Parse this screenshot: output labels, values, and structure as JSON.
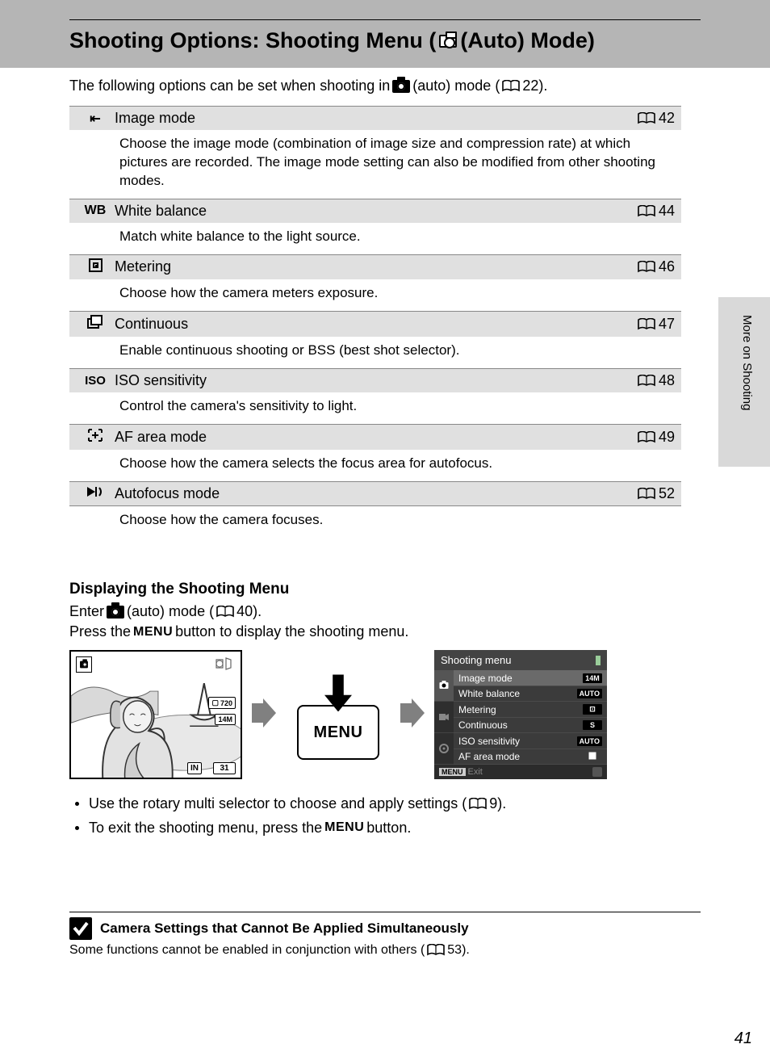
{
  "title_prefix": "Shooting Options: Shooting Menu (",
  "title_mode_word": " (Auto) Mode)",
  "intro_text_1": "The following options can be set when shooting in ",
  "intro_text_2": " (auto) mode (",
  "intro_ref": " 22).",
  "options": [
    {
      "label": "Image mode",
      "page": "42",
      "desc": "Choose the image mode (combination of image size and compression rate) at which pictures are recorded. The image mode setting can also be modified from other shooting modes."
    },
    {
      "label": "White balance",
      "page": "44",
      "desc": "Match white balance to the light source."
    },
    {
      "label": "Metering",
      "page": "46",
      "desc": "Choose how the camera meters exposure."
    },
    {
      "label": "Continuous",
      "page": "47",
      "desc": "Enable continuous shooting or BSS (best shot selector)."
    },
    {
      "label": "ISO sensitivity",
      "page": "48",
      "desc": "Control the camera's sensitivity to light."
    },
    {
      "label": "AF area mode",
      "page": "49",
      "desc": "Choose how the camera selects the focus area for autofocus."
    },
    {
      "label": "Autofocus mode",
      "page": "52",
      "desc": "Choose how the camera focuses."
    }
  ],
  "option_icons": {
    "image_mode_glyph": "⇤",
    "wb_glyph": "WB",
    "metering_glyph": "⊡",
    "continuous_glyph": "❐",
    "iso_glyph": "ISO",
    "af_area_glyph": "[+]",
    "autofocus_glyph": "▷)"
  },
  "subtitle": "Displaying the Shooting Menu",
  "enter_text_1": "Enter ",
  "enter_text_2": " (auto) mode (",
  "enter_ref": " 40).",
  "press_text_1": "Press the ",
  "press_menu": "MENU",
  "press_text_2": " button to display the shooting menu.",
  "menu_button_label": "MENU",
  "camera_menu": {
    "title": "Shooting menu",
    "items": [
      {
        "label": "Image mode",
        "value": "14M"
      },
      {
        "label": "White balance",
        "value": "AUTO"
      },
      {
        "label": "Metering",
        "value": "⊡"
      },
      {
        "label": "Continuous",
        "value": "S"
      },
      {
        "label": "ISO sensitivity",
        "value": "AUTO"
      },
      {
        "label": "AF area mode",
        "value": "▮"
      }
    ],
    "exit_label": "Exit",
    "exit_tag": "MENU"
  },
  "screen_badges": {
    "movie": "720",
    "res": "14M",
    "card": "IN",
    "count": "31"
  },
  "bullets": [
    {
      "t1": "Use the rotary multi selector to choose and apply settings (",
      "ref": " 9)."
    },
    {
      "t1": "To exit the shooting menu, press the ",
      "menu": "MENU",
      "t2": " button."
    }
  ],
  "note": {
    "icon": "V",
    "title": "Camera Settings that Cannot Be Applied Simultaneously",
    "body_1": "Some functions cannot be enabled in conjunction with others (",
    "body_ref": " 53)."
  },
  "side_tab": "More on Shooting",
  "page_number": "41"
}
